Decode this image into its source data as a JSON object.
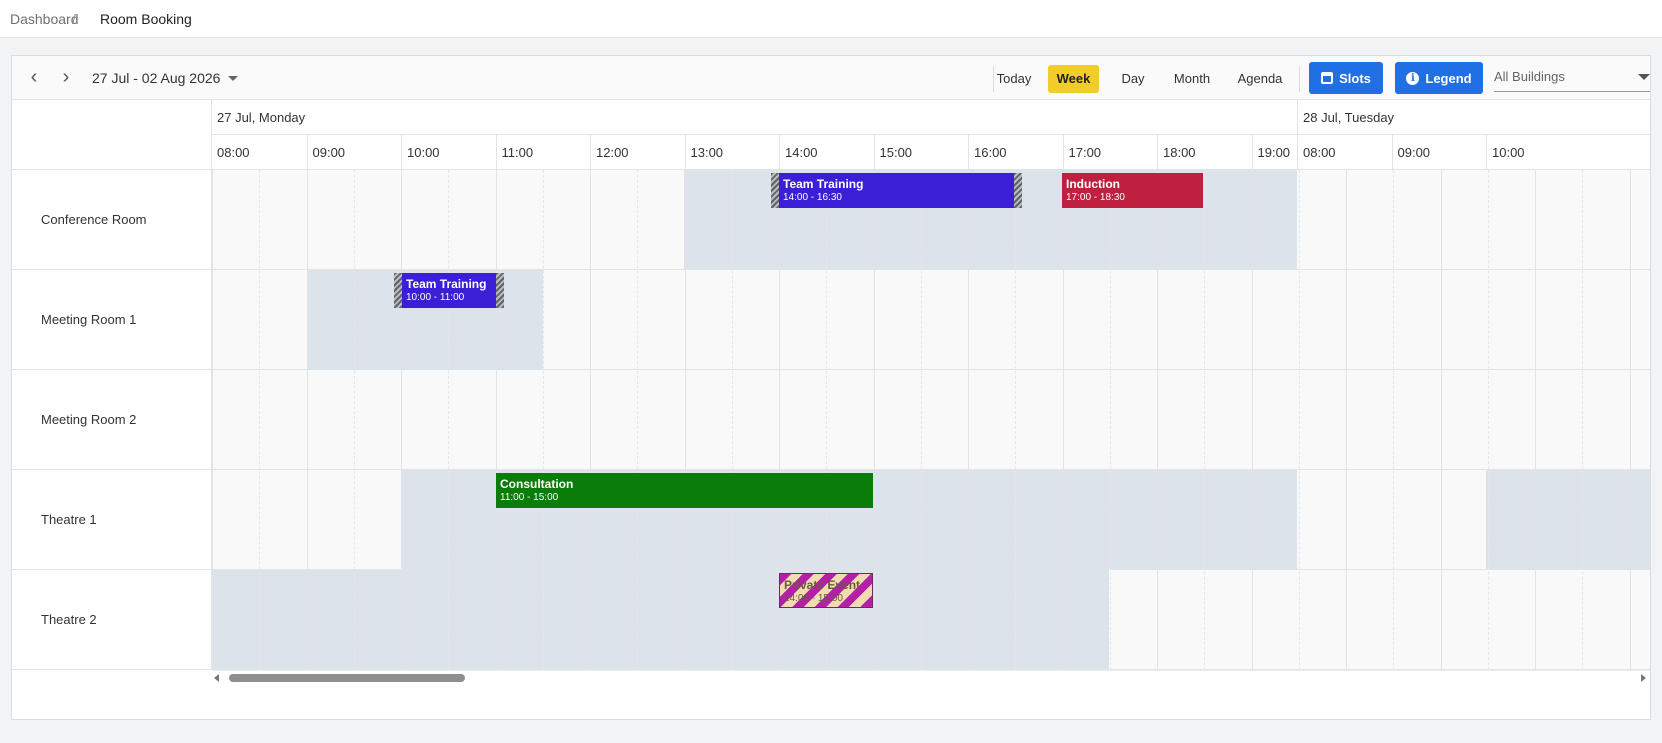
{
  "breadcrumb": {
    "home": "Dashboard",
    "separator": "/",
    "current": "Room Booking"
  },
  "toolbar": {
    "date_range": "27 Jul - 02 Aug 2026",
    "views": {
      "today": "Today",
      "week": "Week",
      "day": "Day",
      "month": "Month",
      "agenda": "Agenda"
    },
    "active_view": "Week",
    "slots_label": "Slots",
    "legend_label": "Legend",
    "building_select": "All Buildings",
    "icons": {
      "prev": "chevron-left-icon",
      "next": "chevron-right-icon",
      "slots": "calendar-icon",
      "legend": "info-icon"
    }
  },
  "dates": [
    {
      "label": "27 Jul, Monday"
    },
    {
      "label": "28 Jul, Tuesday"
    }
  ],
  "hours": {
    "monday": [
      "08:00",
      "09:00",
      "10:00",
      "11:00",
      "12:00",
      "13:00",
      "14:00",
      "15:00",
      "16:00",
      "17:00",
      "18:00",
      "19:00"
    ],
    "tuesday": [
      "08:00",
      "09:00",
      "10:00"
    ]
  },
  "resources": [
    {
      "name": "Conference Room"
    },
    {
      "name": "Meeting Room 1"
    },
    {
      "name": "Meeting Room 2"
    },
    {
      "name": "Theatre 1"
    },
    {
      "name": "Theatre 2"
    }
  ],
  "events": [
    {
      "title": "Team Training",
      "time": "14:00 - 16:30",
      "room": "Conference Room",
      "color": "#3a1fd6"
    },
    {
      "title": "Induction",
      "time": "17:00 - 18:30",
      "room": "Conference Room",
      "color": "#c0203f"
    },
    {
      "title": "Team Training",
      "time": "10:00 - 11:00",
      "room": "Meeting Room 1",
      "color": "#3a1fd6"
    },
    {
      "title": "Consultation",
      "time": "11:00 - 15:00",
      "room": "Theatre 1",
      "color": "#0a7c0a"
    },
    {
      "title": "Private Event",
      "time": "14:00 - 15:00",
      "room": "Theatre 2",
      "color": "#b51ea8"
    }
  ],
  "colors": {
    "week_active": "#f1cd2c",
    "primary_button": "#1f6fe5",
    "available_slot": "#dde3ea"
  }
}
